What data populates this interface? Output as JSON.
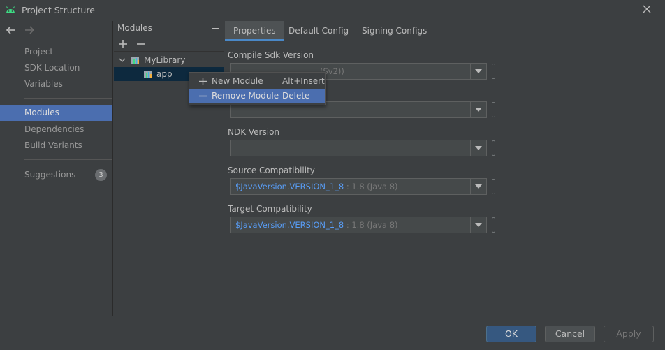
{
  "window": {
    "title": "Project Structure",
    "accent": "#4b6eaf"
  },
  "nav": {
    "back_icon": "arrow-left-icon",
    "forward_icon": "arrow-right-icon",
    "items": [
      {
        "label": "Project"
      },
      {
        "label": "SDK Location"
      },
      {
        "label": "Variables"
      },
      {
        "label": "Modules",
        "selected": true
      },
      {
        "label": "Dependencies"
      },
      {
        "label": "Build Variants"
      },
      {
        "label": "Suggestions",
        "badge": "3"
      }
    ]
  },
  "modules_panel": {
    "header": "Modules",
    "tree": [
      {
        "label": "MyLibrary",
        "expanded": true
      },
      {
        "label": "app",
        "selected": true
      }
    ]
  },
  "context_menu": {
    "items": [
      {
        "label": "New Module",
        "shortcut": "Alt+Insert",
        "icon": "plus-icon"
      },
      {
        "label": "Remove Module",
        "shortcut": "Delete",
        "icon": "minus-icon",
        "highlighted": true
      }
    ]
  },
  "tabs": [
    {
      "label": "Properties",
      "active": true
    },
    {
      "label": "Default Config"
    },
    {
      "label": "Signing Configs"
    }
  ],
  "properties": {
    "compile_sdk": {
      "label": "Compile Sdk Version",
      "value_hidden": "(Sv2))"
    },
    "second_field": {
      "value": ""
    },
    "ndk": {
      "label": "NDK Version",
      "value": ""
    },
    "source_compat": {
      "label": "Source Compatibility",
      "ref": "$JavaVersion.VERSION_1_8",
      "sep": ":",
      "resolved": "1.8 (Java 8)"
    },
    "target_compat": {
      "label": "Target Compatibility",
      "ref": "$JavaVersion.VERSION_1_8",
      "sep": ":",
      "resolved": "1.8 (Java 8)"
    }
  },
  "footer": {
    "ok": "OK",
    "cancel": "Cancel",
    "apply": "Apply"
  }
}
